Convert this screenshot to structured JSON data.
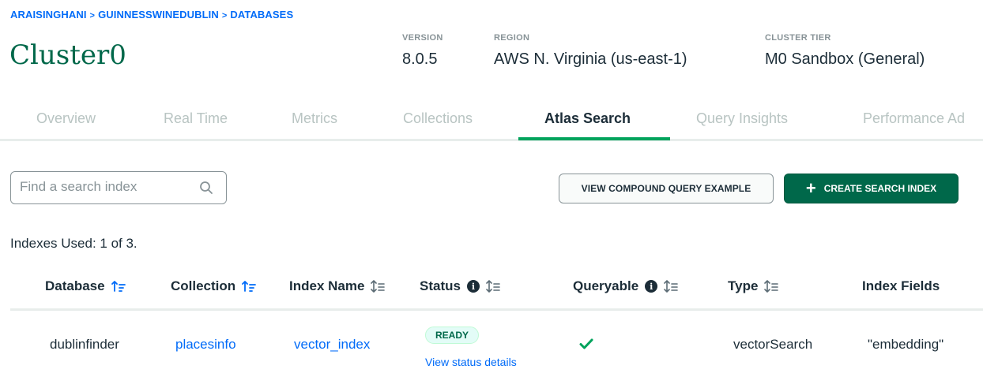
{
  "breadcrumb": {
    "items": [
      "ARAISINGHANI",
      "GUINNESSWINEDUBLIN",
      "DATABASES"
    ],
    "separator": ">"
  },
  "cluster": {
    "name": "Cluster0",
    "version_label": "VERSION",
    "version": "8.0.5",
    "region_label": "REGION",
    "region": "AWS N. Virginia (us-east-1)",
    "tier_label": "CLUSTER TIER",
    "tier": "M0 Sandbox (General)"
  },
  "tabs": [
    {
      "label": "Overview"
    },
    {
      "label": "Real Time"
    },
    {
      "label": "Metrics"
    },
    {
      "label": "Collections"
    },
    {
      "label": "Atlas Search",
      "active": true
    },
    {
      "label": "Query Insights"
    },
    {
      "label": "Performance Ad"
    }
  ],
  "search": {
    "placeholder": "Find a search index",
    "value": ""
  },
  "actions": {
    "compound_label": "VIEW COMPOUND QUERY EXAMPLE",
    "create_label": "CREATE SEARCH INDEX"
  },
  "indexes_used": "Indexes Used: 1 of 3.",
  "table": {
    "headers": {
      "database": "Database",
      "collection": "Collection",
      "index_name": "Index Name",
      "status": "Status",
      "queryable": "Queryable",
      "type": "Type",
      "index_fields": "Index Fields"
    },
    "rows": [
      {
        "database": "dublinfinder",
        "collection": "placesinfo",
        "index_name": "vector_index",
        "status": "READY",
        "status_link": "View status details",
        "queryable": true,
        "type": "vectorSearch",
        "index_fields": "\"embedding\""
      }
    ]
  },
  "colors": {
    "brand_green": "#00684a",
    "accent_green": "#00a35c",
    "link_blue": "#016bf8",
    "muted": "#889397"
  }
}
